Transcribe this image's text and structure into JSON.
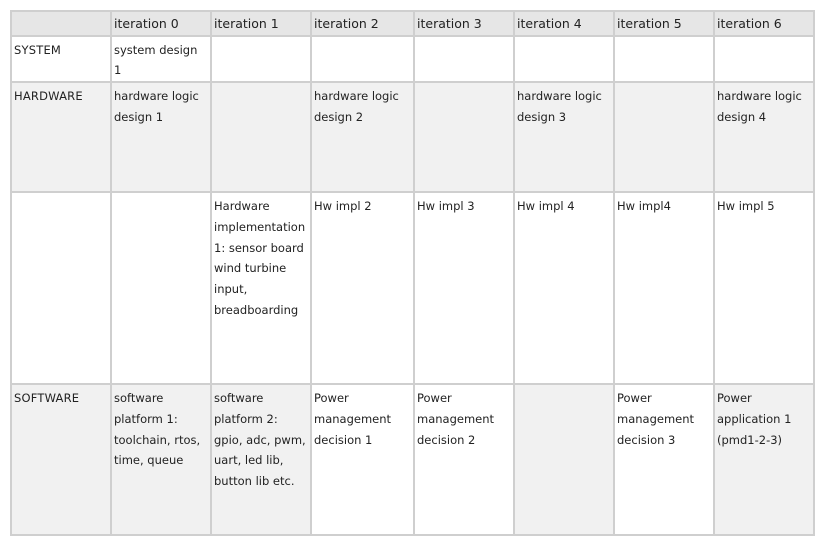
{
  "table": {
    "columns": [
      "",
      "iteration 0",
      "iteration 1",
      "iteration 2",
      "iteration 3",
      "iteration 4",
      "iteration 5",
      "iteration 6"
    ],
    "rows": [
      {
        "label": "SYSTEM",
        "cells": [
          "system design 1",
          "",
          "",
          "",
          "",
          "",
          ""
        ]
      },
      {
        "label": "HARDWARE",
        "cells": [
          "hardware logic design 1",
          "",
          "hardware logic design 2",
          "",
          "hardware logic design 3",
          "",
          "hardware logic design 4"
        ]
      },
      {
        "label": "",
        "cells": [
          "",
          "Hardware implementation 1: sensor board wind turbine input, breadboarding",
          "Hw impl 2",
          "Hw impl 3",
          "Hw impl 4",
          "Hw impl4",
          "Hw impl 5"
        ]
      },
      {
        "label": "SOFTWARE",
        "cells": [
          "software platform 1: toolchain, rtos, time, queue",
          "software platform 2: gpio, adc, pwm, uart, led lib, button lib etc.",
          "Power management decision 1",
          "Power management decision 2",
          "",
          "Power management decision 3",
          "Power application 1 (pmd1-2-3)"
        ]
      }
    ]
  },
  "colors": {
    "header_bg": "#e6e6e6",
    "shaded_bg": "#f1f1f1",
    "grid_line": "#cfcfcf"
  }
}
